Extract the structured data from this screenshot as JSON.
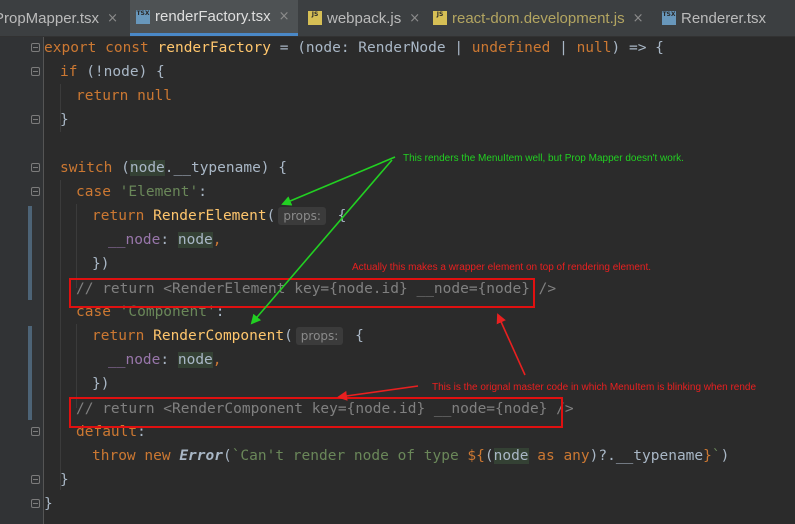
{
  "tabs": [
    {
      "name": "PropMapper.tsx",
      "type": "tsx",
      "active": false
    },
    {
      "name": "renderFactory.tsx",
      "type": "tsx",
      "active": true
    },
    {
      "name": "webpack.js",
      "type": "js",
      "active": false
    },
    {
      "name": "react-dom.development.js",
      "type": "js",
      "active": false
    },
    {
      "name": "Renderer.tsx",
      "type": "tsx",
      "active": false
    }
  ],
  "tab_close_glyph": "×",
  "code": {
    "l1_kw": "export const ",
    "l1_fn": "renderFactory",
    "l1_rest_a": " = (",
    "l1_param": "node",
    "l1_rest_b": ": RenderNode | ",
    "l1_kw2": "undefined",
    "l1_rest_c": " | ",
    "l1_kw3": "null",
    "l1_rest_d": ") => {",
    "l2_kw": "if",
    "l2_rest": " (!node) {",
    "l3_kw": "return null",
    "l4": "}",
    "l6_kw": "switch",
    "l6_a": " (",
    "l6_node": "node",
    "l6_b": ".__typename) {",
    "l7_kw": "case ",
    "l7_str": "'Element'",
    "l7_b": ":",
    "l8_kw": "return ",
    "l8_fn": "RenderElement",
    "l8_a": "(",
    "hint_props": "props:",
    "l8_b": " {",
    "l9_prop": "__node",
    "l9_a": ": ",
    "l9_node": "node",
    "l9_b": ",",
    "l10": "})",
    "l11": "// return <RenderElement key={node.id} __node={node} />",
    "l12_kw": "case ",
    "l12_str": "'Component'",
    "l12_b": ":",
    "l13_kw": "return ",
    "l13_fn": "RenderComponent",
    "l13_a": "(",
    "l13_b": " {",
    "l14_prop": "__node",
    "l14_a": ": ",
    "l14_node": "node",
    "l14_b": ",",
    "l15": "})",
    "l16": "// return <RenderComponent key={node.id} __node={node} />",
    "l17_kw": "default",
    "l17_b": ":",
    "l18_kw": "throw new ",
    "l18_err": "Error",
    "l18_a": "(",
    "l18_str1": "`Can't render node of type ",
    "l18_tpl_open": "${",
    "l18_b": "(",
    "l18_node": "node",
    "l18_kw2": " as any",
    "l18_c": ")?.__typename",
    "l18_tpl_close": "}",
    "l18_str2": "`",
    "l18_d": ")",
    "l19": "}",
    "l20": "}"
  },
  "annotations": {
    "green_note": "This renders the MenuItem well, but Prop Mapper doesn't work.",
    "red_note_1": "Actually this makes a wrapper element on top of rendering element.",
    "red_note_2": "This is the orignal master code in which MenuItem is blinking when rende",
    "green_color": "#22d022",
    "red_color": "#e82020"
  },
  "colors": {
    "editor_bg": "#2b2b2b",
    "keyword": "#cc7832",
    "function": "#ffc66d",
    "string": "#6a8759",
    "comment": "#808080"
  }
}
